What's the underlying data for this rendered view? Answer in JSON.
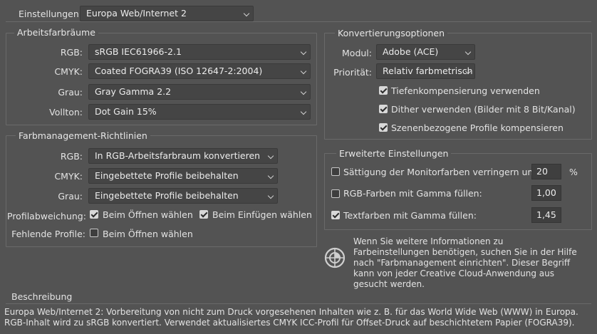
{
  "settings": {
    "label": "Einstellungen:",
    "value": "Europa Web/Internet 2"
  },
  "workspaces": {
    "title": "Arbeitsfarbräume",
    "rgb": {
      "label": "RGB:",
      "value": "sRGB IEC61966-2.1"
    },
    "cmyk": {
      "label": "CMYK:",
      "value": "Coated FOGRA39 (ISO 12647-2:2004)"
    },
    "gray": {
      "label": "Grau:",
      "value": "Gray Gamma 2.2"
    },
    "spot": {
      "label": "Vollton:",
      "value": "Dot Gain 15%"
    }
  },
  "policies": {
    "title": "Farbmanagement-Richtlinien",
    "rgb": {
      "label": "RGB:",
      "value": "In RGB-Arbeitsfarbraum konvertieren"
    },
    "cmyk": {
      "label": "CMYK:",
      "value": "Eingebettete Profile beibehalten"
    },
    "gray": {
      "label": "Grau:",
      "value": "Eingebettete Profile beibehalten"
    },
    "mismatch": {
      "label": "Profilabweichung:",
      "open": "Beim Öffnen wählen",
      "open_checked": true,
      "paste": "Beim Einfügen wählen",
      "paste_checked": true
    },
    "missing": {
      "label": "Fehlende Profile:",
      "open": "Beim Öffnen wählen",
      "open_checked": false
    }
  },
  "conversion": {
    "title": "Konvertierungsoptionen",
    "engine": {
      "label": "Modul:",
      "value": "Adobe (ACE)"
    },
    "intent": {
      "label": "Priorität:",
      "value": "Relativ farbmetrisch"
    },
    "bpc": {
      "label": "Tiefenkompensierung verwenden",
      "checked": true
    },
    "dither": {
      "label": "Dither verwenden (Bilder mit 8 Bit/Kanal)",
      "checked": true
    },
    "scene": {
      "label": "Szenenbezogene Profile kompensieren",
      "checked": true
    }
  },
  "advanced": {
    "title": "Erweiterte Einstellungen",
    "desaturate": {
      "label": "Sättigung der Monitorfarben verringern um:",
      "checked": false,
      "value": "20",
      "unit": "%"
    },
    "blend_rgb": {
      "label": "RGB-Farben mit Gamma füllen:",
      "checked": false,
      "value": "1,00"
    },
    "blend_text": {
      "label": "Textfarben mit Gamma füllen:",
      "checked": true,
      "value": "1,45"
    }
  },
  "info": {
    "text": "Wenn Sie weitere Informationen zu Farbeinstellungen benötigen, suchen Sie in der Hilfe nach \"Farbmanagement einrichten\". Dieser Begriff kann von jeder Creative Cloud-Anwendung aus gesucht werden."
  },
  "description": {
    "title": "Beschreibung",
    "text": "Europa Web/Internet 2:  Vorbereitung von nicht zum Druck vorgesehenen Inhalten wie z. B. für das World Wide Web (WWW) in Europa. RGB-Inhalt wird zu sRGB konvertiert. Verwendet aktualisiertes CMYK ICC-Profil für Offset-Druck auf beschichtetem Papier (FOGRA39)."
  }
}
